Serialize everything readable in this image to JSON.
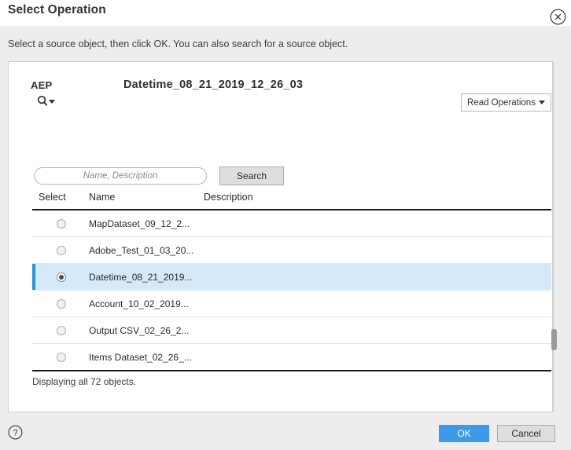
{
  "dialog": {
    "title": "Select Operation",
    "instruction": "Select a source object, then click OK. You can also search for a source object.",
    "close_icon": "close-circle-icon"
  },
  "panel": {
    "connection_label": "AEP",
    "object_title": "Datetime_08_21_2019_12_26_03",
    "search_toggle_icon": "search-magnifier-icon",
    "operations_dropdown": {
      "value": "Read Operations",
      "caret_icon": "chevron-down-icon"
    }
  },
  "search": {
    "placeholder": "Name, Description",
    "value": "",
    "button_label": "Search"
  },
  "table": {
    "columns": [
      "Select",
      "Name",
      "Description"
    ],
    "rows": [
      {
        "name": "MapDataset_09_12_2...",
        "description": "",
        "selected": false
      },
      {
        "name": "Adobe_Test_01_03_20...",
        "description": "",
        "selected": false
      },
      {
        "name": "Datetime_08_21_2019...",
        "description": "",
        "selected": true
      },
      {
        "name": "Account_10_02_2019...",
        "description": "",
        "selected": false
      },
      {
        "name": "Output CSV_02_26_2...",
        "description": "",
        "selected": false
      },
      {
        "name": "Items Dataset_02_26_...",
        "description": "",
        "selected": false
      }
    ],
    "status": "Displaying all 72 objects."
  },
  "footer": {
    "help_icon": "help-circle-icon",
    "ok_label": "OK",
    "cancel_label": "Cancel"
  },
  "colors": {
    "accent_blue": "#3d9ae8",
    "selected_row_bg": "#d6e9f8",
    "selected_row_bar": "#2e8fdd",
    "band_gray": "#ededed"
  }
}
